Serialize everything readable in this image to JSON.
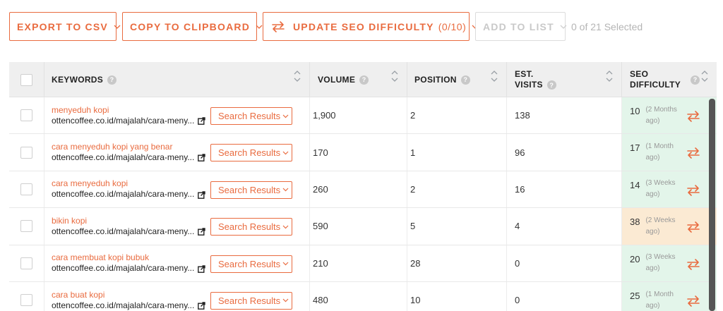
{
  "toolbar": {
    "export_csv": "EXPORT TO CSV",
    "copy_clipboard": "COPY TO CLIPBOARD",
    "update_seo": "UPDATE SEO DIFFICULTY",
    "update_seo_count": "(0/10)",
    "add_to_list": "ADD TO LIST",
    "selected": "0 of 21 Selected"
  },
  "table": {
    "headers": {
      "keywords": "KEYWORDS",
      "volume": "VOLUME",
      "position": "POSITION",
      "est_visits_1": "EST.",
      "est_visits_2": "VISITS",
      "seo_1": "SEO",
      "seo_2": "DIFFICULTY"
    },
    "search_results_label": "Search Results",
    "rows": [
      {
        "keyword": "menyeduh kopi",
        "url": "ottencoffee.co.id/majalah/cara-meny...",
        "volume": "1,900",
        "position": "2",
        "visits": "138",
        "seo": "10",
        "seo_ago": "(2 Months ago)",
        "seo_level": "green"
      },
      {
        "keyword": "cara menyeduh kopi yang benar",
        "url": "ottencoffee.co.id/majalah/cara-meny...",
        "volume": "170",
        "position": "1",
        "visits": "96",
        "seo": "17",
        "seo_ago": "(1 Month ago)",
        "seo_level": "green"
      },
      {
        "keyword": "cara menyeduh kopi",
        "url": "ottencoffee.co.id/majalah/cara-meny...",
        "volume": "260",
        "position": "2",
        "visits": "16",
        "seo": "14",
        "seo_ago": "(3 Weeks ago)",
        "seo_level": "green"
      },
      {
        "keyword": "bikin kopi",
        "url": "ottencoffee.co.id/majalah/cara-meny...",
        "volume": "590",
        "position": "5",
        "visits": "4",
        "seo": "38",
        "seo_ago": "(2 Weeks ago)",
        "seo_level": "orange"
      },
      {
        "keyword": "cara membuat kopi bubuk",
        "url": "ottencoffee.co.id/majalah/cara-meny...",
        "volume": "210",
        "position": "28",
        "visits": "0",
        "seo": "20",
        "seo_ago": "(3 Weeks ago)",
        "seo_level": "green"
      },
      {
        "keyword": "cara buat kopi",
        "url": "ottencoffee.co.id/majalah/cara-meny...",
        "volume": "480",
        "position": "10",
        "visits": "0",
        "seo": "25",
        "seo_ago": "(1 Month ago)",
        "seo_level": "green"
      }
    ]
  },
  "colors": {
    "accent": "#e96b3f",
    "seo_green": "#e3f5ea",
    "seo_orange": "#fbead3"
  },
  "icons": [
    "chevron-down-icon",
    "sync-icon",
    "help-icon",
    "sort-icon",
    "external-link-icon",
    "refresh-icon"
  ]
}
